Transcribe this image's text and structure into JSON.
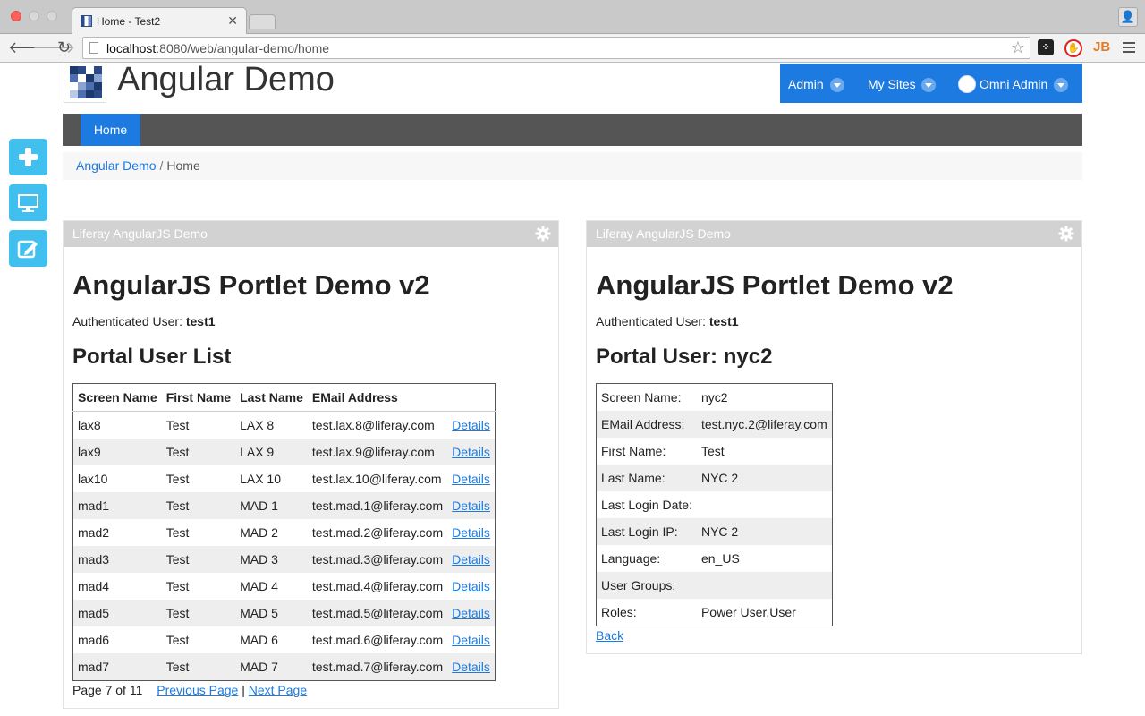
{
  "browser": {
    "tab_title": "Home - Test2",
    "url_host": "localhost",
    "url_rest": ":8080/web/angular-demo/home"
  },
  "site": {
    "title": "Angular Demo"
  },
  "userbar": {
    "admin": "Admin",
    "my_sites": "My Sites",
    "user": "Omni Admin"
  },
  "nav": {
    "home": "Home"
  },
  "breadcrumb": {
    "root": "Angular Demo",
    "separator": "/",
    "current": "Home"
  },
  "dock": {
    "icons": [
      "add-icon",
      "preview-icon",
      "edit-icon"
    ]
  },
  "left_portlet": {
    "header": "Liferay AngularJS Demo",
    "title": "AngularJS Portlet Demo v2",
    "auth_label": "Authenticated User:",
    "auth_user": "test1",
    "list_title": "Portal User List",
    "columns": [
      "Screen Name",
      "First Name",
      "Last Name",
      "EMail Address"
    ],
    "rows": [
      {
        "screen": "lax8",
        "first": "Test",
        "last": "LAX 8",
        "email": "test.lax.8@liferay.com",
        "action": "Details"
      },
      {
        "screen": "lax9",
        "first": "Test",
        "last": "LAX 9",
        "email": "test.lax.9@liferay.com",
        "action": "Details"
      },
      {
        "screen": "lax10",
        "first": "Test",
        "last": "LAX 10",
        "email": "test.lax.10@liferay.com",
        "action": "Details"
      },
      {
        "screen": "mad1",
        "first": "Test",
        "last": "MAD 1",
        "email": "test.mad.1@liferay.com",
        "action": "Details"
      },
      {
        "screen": "mad2",
        "first": "Test",
        "last": "MAD 2",
        "email": "test.mad.2@liferay.com",
        "action": "Details"
      },
      {
        "screen": "mad3",
        "first": "Test",
        "last": "MAD 3",
        "email": "test.mad.3@liferay.com",
        "action": "Details"
      },
      {
        "screen": "mad4",
        "first": "Test",
        "last": "MAD 4",
        "email": "test.mad.4@liferay.com",
        "action": "Details"
      },
      {
        "screen": "mad5",
        "first": "Test",
        "last": "MAD 5",
        "email": "test.mad.5@liferay.com",
        "action": "Details"
      },
      {
        "screen": "mad6",
        "first": "Test",
        "last": "MAD 6",
        "email": "test.mad.6@liferay.com",
        "action": "Details"
      },
      {
        "screen": "mad7",
        "first": "Test",
        "last": "MAD 7",
        "email": "test.mad.7@liferay.com",
        "action": "Details"
      }
    ],
    "pager": {
      "text": "Page 7 of 11",
      "previous": "Previous Page",
      "divider": "|",
      "next": "Next Page"
    }
  },
  "right_portlet": {
    "header": "Liferay AngularJS Demo",
    "title": "AngularJS Portlet Demo v2",
    "auth_label": "Authenticated User:",
    "auth_user": "test1",
    "detail_title": "Portal User: nyc2",
    "fields": [
      {
        "label": "Screen Name:",
        "value": "nyc2"
      },
      {
        "label": "EMail Address:",
        "value": "test.nyc.2@liferay.com"
      },
      {
        "label": "First Name:",
        "value": "Test"
      },
      {
        "label": "Last Name:",
        "value": "NYC 2"
      },
      {
        "label": "Last Login Date:",
        "value": ""
      },
      {
        "label": "Last Login IP:",
        "value": "NYC 2"
      },
      {
        "label": "Language:",
        "value": "en_US"
      },
      {
        "label": "User Groups:",
        "value": ""
      },
      {
        "label": "Roles:",
        "value": "Power User,User"
      }
    ],
    "back": "Back"
  },
  "colors": {
    "primary": "#1c7ae0",
    "navbar": "#555555",
    "dock": "#41c0f0",
    "portlet_header": "#d2d2d2"
  }
}
